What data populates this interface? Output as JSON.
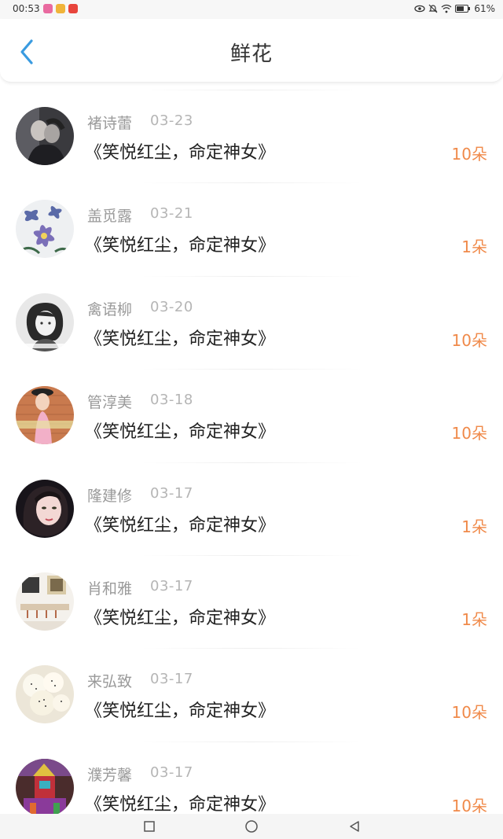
{
  "status_bar": {
    "time": "00:53",
    "battery_percent": "61%",
    "app_icons": [
      {
        "name": "app-icon-pink",
        "color": "#e96aa0"
      },
      {
        "name": "app-icon-yellow",
        "color": "#f0b43a"
      },
      {
        "name": "app-icon-red",
        "color": "#e8453c"
      }
    ]
  },
  "header": {
    "title": "鲜花",
    "back_icon": "chevron-left-icon"
  },
  "colors": {
    "accent_blue": "#3a9be0",
    "count_orange": "#f08a4a",
    "name_gray": "#9a9a9a",
    "date_gray": "#b5b5b5"
  },
  "gifts": [
    {
      "name": "褚诗蕾",
      "date": "03-23",
      "book": "《笑悦红尘，命定神女》",
      "count": "10朵",
      "avatar": "avatar-couple-dark"
    },
    {
      "name": "盖觅露",
      "date": "03-21",
      "book": "《笑悦红尘，命定神女》",
      "count": "1朵",
      "avatar": "avatar-blue-flowers"
    },
    {
      "name": "禽语柳",
      "date": "03-20",
      "book": "《笑悦红尘，命定神女》",
      "count": "10朵",
      "avatar": "avatar-bw-girl"
    },
    {
      "name": "管淳美",
      "date": "03-18",
      "book": "《笑悦红尘，命定神女》",
      "count": "10朵",
      "avatar": "avatar-girl-brick-wall"
    },
    {
      "name": "隆建修",
      "date": "03-17",
      "book": "《笑悦红尘，命定神女》",
      "count": "1朵",
      "avatar": "avatar-girl-portrait"
    },
    {
      "name": "肖和雅",
      "date": "03-17",
      "book": "《笑悦红尘，命定神女》",
      "count": "1朵",
      "avatar": "avatar-room-shelf"
    },
    {
      "name": "来弘致",
      "date": "03-17",
      "book": "《笑悦红尘，命定神女》",
      "count": "10朵",
      "avatar": "avatar-white-buns"
    },
    {
      "name": "濮芳馨",
      "date": "03-17",
      "book": "《笑悦红尘，命定神女》",
      "count": "10朵",
      "avatar": "avatar-colorful-figure"
    }
  ],
  "nav_bar": {
    "buttons": [
      "recents-square-icon",
      "home-circle-icon",
      "back-triangle-icon"
    ]
  }
}
